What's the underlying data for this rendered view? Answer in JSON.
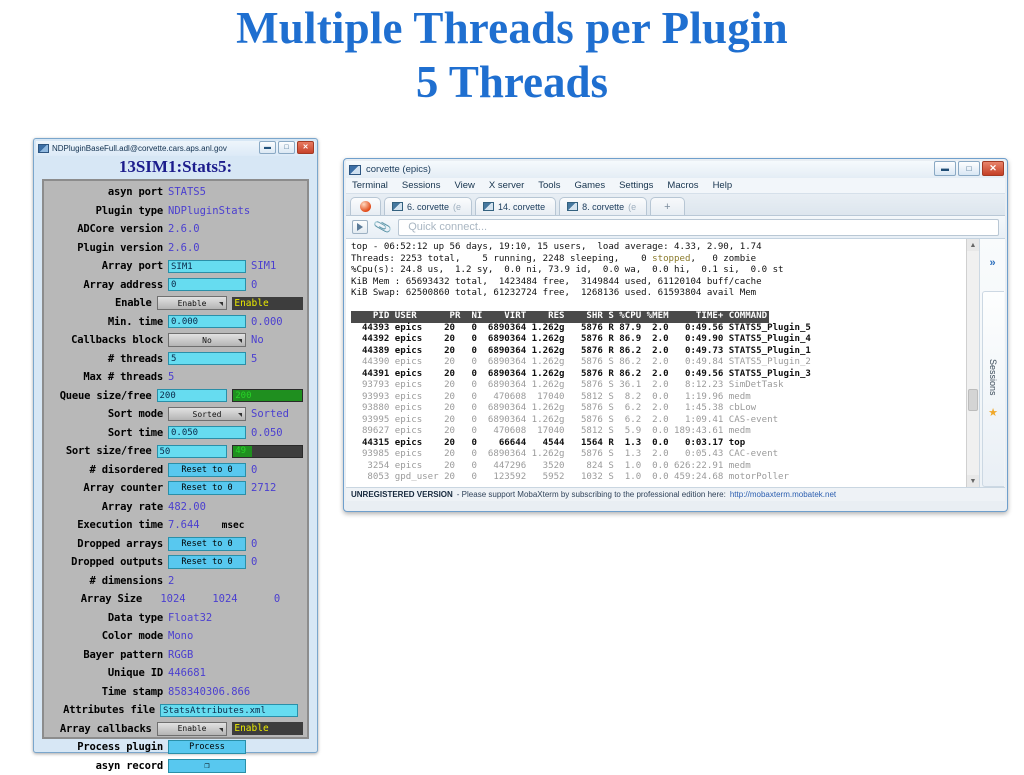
{
  "slide": {
    "title_line1": "Multiple Threads per Plugin",
    "title_line2": "5 Threads",
    "title_color": "#1f6fd0"
  },
  "medm": {
    "titlebar": "NDPluginBaseFull.adl@corvette.cars.aps.anl.gov",
    "header": "13SIM1:Stats5:",
    "window_buttons": [
      "minimize",
      "maximize",
      "close"
    ],
    "rows": [
      {
        "label": "asyn port",
        "kind": "text",
        "value": "STATS5"
      },
      {
        "label": "Plugin type",
        "kind": "text",
        "value": "NDPluginStats"
      },
      {
        "label": "ADCore version",
        "kind": "text",
        "value": "2.6.0"
      },
      {
        "label": "Plugin version",
        "kind": "text",
        "value": "2.6.0"
      },
      {
        "label": "Array port",
        "kind": "field",
        "field": "SIM1",
        "value": "SIM1"
      },
      {
        "label": "Array address",
        "kind": "field",
        "field": "0",
        "value": "0"
      },
      {
        "label": "Enable",
        "kind": "menu-state",
        "field": "Enable",
        "value": "Enable"
      },
      {
        "label": "Min. time",
        "kind": "field",
        "field": "0.000",
        "value": "0.000"
      },
      {
        "label": "Callbacks block",
        "kind": "menu",
        "field": "No",
        "value": "No"
      },
      {
        "label": "# threads",
        "kind": "field",
        "field": "5",
        "value": "5"
      },
      {
        "label": "Max # threads",
        "kind": "text",
        "value": "5"
      },
      {
        "label": "Queue size/free",
        "kind": "field-bar",
        "field": "200",
        "value": "200",
        "fill_pct": 100
      },
      {
        "label": "Sort mode",
        "kind": "menu",
        "field": "Sorted",
        "value": "Sorted"
      },
      {
        "label": "Sort time",
        "kind": "field",
        "field": "0.050",
        "value": "0.050"
      },
      {
        "label": "Sort size/free",
        "kind": "field-bar",
        "field": "50",
        "value": "49",
        "fill_pct": 28
      },
      {
        "label": "# disordered",
        "kind": "button",
        "field": "Reset to 0",
        "value": "0"
      },
      {
        "label": "Array counter",
        "kind": "button",
        "field": "Reset to 0",
        "value": "2712"
      },
      {
        "label": "Array rate",
        "kind": "text",
        "value": "482.00"
      },
      {
        "label": "Execution time",
        "kind": "text-unit",
        "value": "7.644",
        "unit": "msec"
      },
      {
        "label": "Dropped arrays",
        "kind": "button",
        "field": "Reset to 0",
        "value": "0"
      },
      {
        "label": "Dropped outputs",
        "kind": "button",
        "field": "Reset to 0",
        "value": "0"
      },
      {
        "label": "# dimensions",
        "kind": "text",
        "value": "2"
      },
      {
        "label": "Array Size",
        "kind": "triple",
        "v1": "1024",
        "v2": "1024",
        "v3": "0"
      },
      {
        "label": "Data type",
        "kind": "text",
        "value": "Float32"
      },
      {
        "label": "Color mode",
        "kind": "text",
        "value": "Mono"
      },
      {
        "label": "Bayer pattern",
        "kind": "text",
        "value": "RGGB"
      },
      {
        "label": "Unique ID",
        "kind": "text",
        "value": "446681"
      },
      {
        "label": "Time stamp",
        "kind": "text",
        "value": "858340306.866"
      },
      {
        "label": "Attributes file",
        "kind": "field-wide",
        "field": "StatsAttributes.xml"
      },
      {
        "label": "Array callbacks",
        "kind": "menu-state",
        "field": "Enable",
        "value": "Enable"
      },
      {
        "label": "Process plugin",
        "kind": "button-only",
        "field": "Process"
      },
      {
        "label": "asyn record",
        "kind": "button-only",
        "field": "❐"
      }
    ]
  },
  "moba": {
    "titlebar": "corvette (epics)",
    "menu": [
      "Terminal",
      "Sessions",
      "View",
      "X server",
      "Tools",
      "Games",
      "Settings",
      "Macros",
      "Help"
    ],
    "tabs": [
      {
        "label": "",
        "kind": "home"
      },
      {
        "label": "6. corvette",
        "suffix": "(e",
        "kind": "session"
      },
      {
        "label": "14. corvette",
        "suffix": "",
        "kind": "session"
      },
      {
        "label": "8. corvette",
        "suffix": "(e",
        "kind": "session"
      },
      {
        "label": "+",
        "kind": "new"
      }
    ],
    "quick_connect_placeholder": "Quick connect...",
    "sidebar": {
      "label": "Sessions",
      "chevron": "»",
      "star": "★"
    },
    "status": {
      "bold": "UNREGISTERED VERSION",
      "text": "- Please support MobaXterm by subscribing to the professional edition here:",
      "link": "http://mobaxterm.mobatek.net"
    },
    "terminal": {
      "summary": [
        "top - 06:52:12 up 56 days, 19:10, 15 users,  load average: 4.33, 2.90, 1.74",
        "Threads: 2253 total,    5 running, 2248 sleeping,    0 stopped,   0 zombie",
        "%Cpu(s): 24.8 us,  1.2 sy,  0.0 ni, 73.9 id,  0.0 wa,  0.0 hi,  0.1 si,  0.0 st",
        "KiB Mem : 65693432 total,  1423484 free,  3149844 used, 61120104 buff/cache",
        "KiB Swap: 62500860 total, 61232724 free,  1268136 used. 61593804 avail Mem"
      ],
      "header": "    PID USER      PR  NI    VIRT    RES    SHR S %CPU %MEM     TIME+ COMMAND",
      "rows": [
        {
          "pid": "44393",
          "user": "epics",
          "pr": "20",
          "ni": "0",
          "virt": "6890364",
          "res": "1.262g",
          "shr": "5876",
          "s": "R",
          "cpu": "87.9",
          "mem": "2.0",
          "time": "0:49.56",
          "command": "STATS5_Plugin_5",
          "style": "bold"
        },
        {
          "pid": "44392",
          "user": "epics",
          "pr": "20",
          "ni": "0",
          "virt": "6890364",
          "res": "1.262g",
          "shr": "5876",
          "s": "R",
          "cpu": "86.9",
          "mem": "2.0",
          "time": "0:49.90",
          "command": "STATS5_Plugin_4",
          "style": "bold"
        },
        {
          "pid": "44389",
          "user": "epics",
          "pr": "20",
          "ni": "0",
          "virt": "6890364",
          "res": "1.262g",
          "shr": "5876",
          "s": "R",
          "cpu": "86.2",
          "mem": "2.0",
          "time": "0:49.73",
          "command": "STATS5_Plugin_1",
          "style": "bold"
        },
        {
          "pid": "44390",
          "user": "epics",
          "pr": "20",
          "ni": "0",
          "virt": "6890364",
          "res": "1.262g",
          "shr": "5876",
          "s": "S",
          "cpu": "86.2",
          "mem": "2.0",
          "time": "0:49.84",
          "command": "STATS5_Plugin_2",
          "style": "dim"
        },
        {
          "pid": "44391",
          "user": "epics",
          "pr": "20",
          "ni": "0",
          "virt": "6890364",
          "res": "1.262g",
          "shr": "5876",
          "s": "R",
          "cpu": "86.2",
          "mem": "2.0",
          "time": "0:49.56",
          "command": "STATS5_Plugin_3",
          "style": "bold"
        },
        {
          "pid": "93793",
          "user": "epics",
          "pr": "20",
          "ni": "0",
          "virt": "6890364",
          "res": "1.262g",
          "shr": "5876",
          "s": "S",
          "cpu": "36.1",
          "mem": "2.0",
          "time": "8:12.23",
          "command": "SimDetTask",
          "style": "dim"
        },
        {
          "pid": "93993",
          "user": "epics",
          "pr": "20",
          "ni": "0",
          "virt": "470608",
          "res": "17040",
          "shr": "5812",
          "s": "S",
          "cpu": "8.2",
          "mem": "0.0",
          "time": "1:19.96",
          "command": "medm",
          "style": "dim"
        },
        {
          "pid": "93880",
          "user": "epics",
          "pr": "20",
          "ni": "0",
          "virt": "6890364",
          "res": "1.262g",
          "shr": "5876",
          "s": "S",
          "cpu": "6.2",
          "mem": "2.0",
          "time": "1:45.38",
          "command": "cbLow",
          "style": "dim"
        },
        {
          "pid": "93995",
          "user": "epics",
          "pr": "20",
          "ni": "0",
          "virt": "6890364",
          "res": "1.262g",
          "shr": "5876",
          "s": "S",
          "cpu": "6.2",
          "mem": "2.0",
          "time": "1:09.41",
          "command": "CAS-event",
          "style": "dim"
        },
        {
          "pid": "89627",
          "user": "epics",
          "pr": "20",
          "ni": "0",
          "virt": "470608",
          "res": "17040",
          "shr": "5812",
          "s": "S",
          "cpu": "5.9",
          "mem": "0.0",
          "time": "189:43.61",
          "command": "medm",
          "style": "dim"
        },
        {
          "pid": "44315",
          "user": "epics",
          "pr": "20",
          "ni": "0",
          "virt": "66644",
          "res": "4544",
          "shr": "1564",
          "s": "R",
          "cpu": "1.3",
          "mem": "0.0",
          "time": "0:03.17",
          "command": "top",
          "style": "bold"
        },
        {
          "pid": "93985",
          "user": "epics",
          "pr": "20",
          "ni": "0",
          "virt": "6890364",
          "res": "1.262g",
          "shr": "5876",
          "s": "S",
          "cpu": "1.3",
          "mem": "2.0",
          "time": "0:05.43",
          "command": "CAC-event",
          "style": "dim"
        },
        {
          "pid": "3254",
          "user": "epics",
          "pr": "20",
          "ni": "0",
          "virt": "447296",
          "res": "3520",
          "shr": "824",
          "s": "S",
          "cpu": "1.0",
          "mem": "0.0",
          "time": "626:22.91",
          "command": "medm",
          "style": "dim"
        },
        {
          "pid": "8053",
          "user": "gpd_user",
          "pr": "20",
          "ni": "0",
          "virt": "123592",
          "res": "5952",
          "shr": "1032",
          "s": "S",
          "cpu": "1.0",
          "mem": "0.0",
          "time": "459:24.68",
          "command": "motorPoller",
          "style": "dim"
        }
      ]
    }
  }
}
